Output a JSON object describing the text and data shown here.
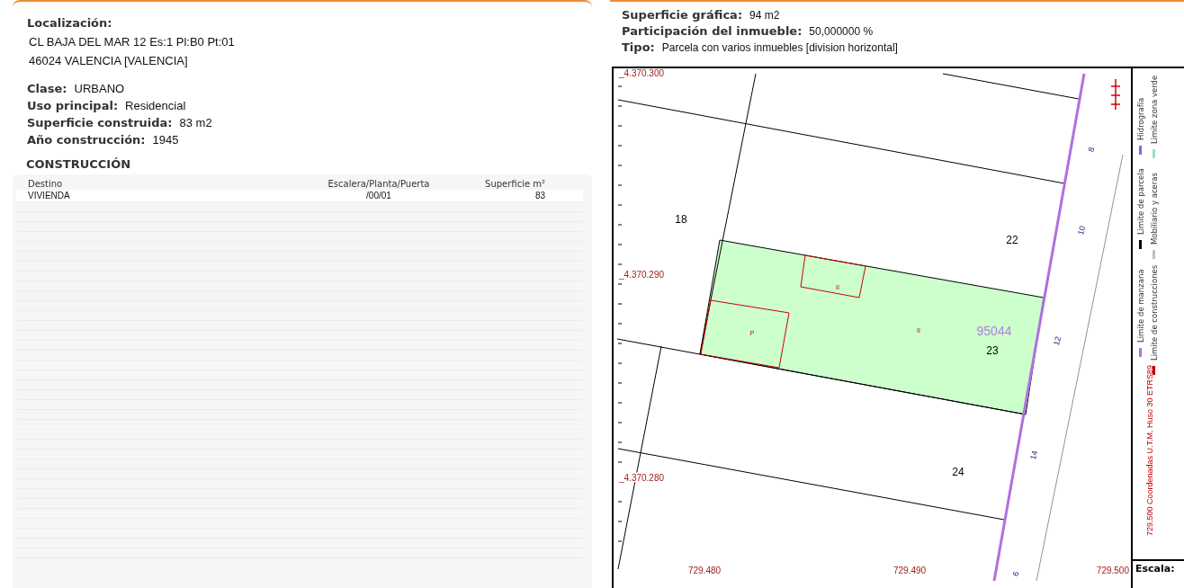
{
  "property": {
    "location_label": "Localización:",
    "address_lines": [
      "CL BAJA DEL MAR 12 Es:1 Pl:B0 Pt:01",
      "46024 VALENCIA [VALENCIA]"
    ],
    "fields": [
      {
        "label": "Clase:",
        "value": "URBANO"
      },
      {
        "label": "Uso principal:",
        "value": "Residencial"
      },
      {
        "label": "Superficie construida:",
        "value": "83 m2"
      },
      {
        "label": "Año construcción:",
        "value": "1945"
      }
    ]
  },
  "construction": {
    "title": "CONSTRUCCIÓN",
    "columns": [
      "Destino",
      "Escalera/Planta/Puerta",
      "Superficie m²"
    ],
    "rows": [
      [
        "VIVIENDA",
        "/00/01",
        "83"
      ]
    ]
  },
  "parcel": {
    "fields": [
      {
        "label": "Superficie gráfica:",
        "value": "94 m2"
      },
      {
        "label": "Participación del inmueble:",
        "value": "50,000000 %"
      },
      {
        "label": "Tipo:",
        "value": "Parcela con varios inmuebles [division horizontal]"
      }
    ]
  },
  "map": {
    "northing_labels": [
      "_4.370.300",
      "_4.370.290",
      "_4.370.280"
    ],
    "easting_labels": [
      "729.480",
      "729.490",
      "729.500"
    ],
    "parcel_numbers": [
      "18",
      "22",
      "23",
      "24"
    ],
    "cadastral_ref": "95044",
    "unit_labels": [
      "II",
      "P",
      "II"
    ],
    "street_numbers": [
      "8",
      "10",
      "12",
      "14",
      "6"
    ]
  },
  "legend": {
    "items": [
      {
        "label": "Limite de manzana",
        "color": "#b070e0"
      },
      {
        "label": "Limite de parcela",
        "color": "#000000"
      },
      {
        "label": "Hidrografía",
        "color": "#7070e0"
      },
      {
        "label": "Limite de construcciones",
        "color": "#c00000"
      },
      {
        "label": "Mobiliario y aceras",
        "color": "#c0c0c0"
      },
      {
        "label": "Limite zona verde",
        "color": "#a0e0c0"
      }
    ],
    "coordinate_note": "729.500 Coordenadas U.T.M. Huso 30 ETRS89",
    "scale_label": "Escala:"
  }
}
